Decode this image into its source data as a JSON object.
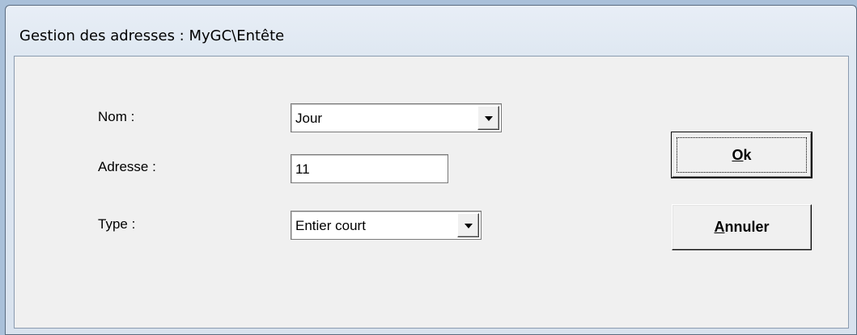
{
  "window": {
    "title": "Gestion des adresses : MyGC\\Entête"
  },
  "form": {
    "nom_label": "Nom :",
    "nom_value": "Jour",
    "adresse_label": "Adresse :",
    "adresse_value": "11",
    "type_label": "Type :",
    "type_value": "Entier court"
  },
  "buttons": {
    "ok_mnemonic": "O",
    "ok_rest": "k",
    "annuler_mnemonic": "A",
    "annuler_rest": "nnuler"
  },
  "icons": {
    "dropdown": "chevron-down-icon"
  }
}
